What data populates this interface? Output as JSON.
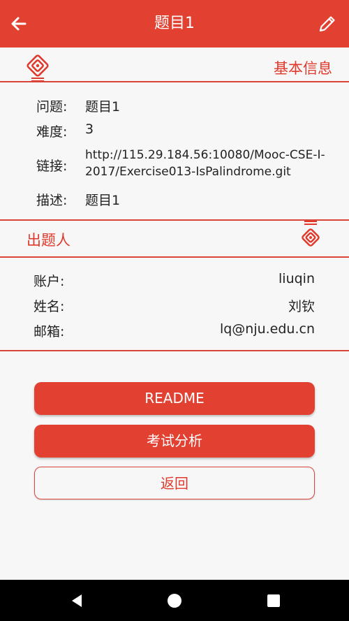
{
  "appbar": {
    "title": "题目1",
    "back_icon": "arrow-left-icon",
    "edit_icon": "pencil-icon"
  },
  "basic_info": {
    "section_title": "基本信息",
    "fields": [
      {
        "label": "问题:",
        "value": "题目1"
      },
      {
        "label": "难度:",
        "value": "3"
      },
      {
        "label": "链接:",
        "value": "http://115.29.184.56:10080/Mooc-CSE-I-2017/Exercise013-IsPalindrome.git"
      },
      {
        "label": "描述:",
        "value": "题目1"
      }
    ]
  },
  "author": {
    "section_title": "出题人",
    "fields": [
      {
        "label": "账户:",
        "value": "liuqin"
      },
      {
        "label": "姓名:",
        "value": "刘钦"
      },
      {
        "label": "邮箱:",
        "value": "lq@nju.edu.cn"
      }
    ]
  },
  "actions": {
    "readme_label": "README",
    "analysis_label": "考试分析",
    "back_label": "返回"
  },
  "system_nav": {
    "back_icon": "triangle-back-icon",
    "home_icon": "circle-home-icon",
    "recents_icon": "square-recents-icon"
  },
  "colors": {
    "accent": "#e24132",
    "background": "#f7f7f7"
  }
}
